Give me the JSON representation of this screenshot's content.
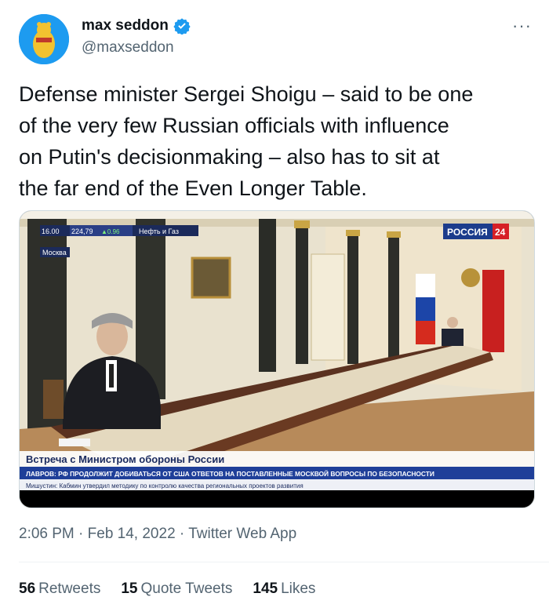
{
  "author": {
    "name": "max seddon",
    "handle": "@maxseddon",
    "verified": true,
    "avatar_icon": "bear-avatar-icon"
  },
  "more_icon": "more-options-icon",
  "tweet_text": "Defense minister Sergei Shoigu – said to be one\nof the very few Russian officials with influence\non Putin's decisionmaking – also has to sit at\nthe far end of the Even Longer Table.",
  "media": {
    "ticker_time": "16.00",
    "ticker_value": "224,79",
    "ticker_change": "▲0.96",
    "ticker_sector": "Нефть и Газ",
    "location": "Москва",
    "channel_logo": "РОССИЯ",
    "channel_number": "24",
    "headline": "Встреча с Министром обороны России",
    "crawl_1": "ЛАВРОВ: РФ ПРОДОЛЖИТ ДОБИВАТЬСЯ ОТ США ОТВЕТОВ НА ПОСТАВЛЕННЫЕ МОСКВОЙ ВОПРОСЫ ПО БЕЗОПАСНОСТИ",
    "crawl_2": "Мишустин: Кабмин утвердил методику по контролю качества региональных проектов развития"
  },
  "meta": {
    "time": "2:06 PM",
    "date": "Feb 14, 2022",
    "source": "Twitter Web App",
    "separator": " · "
  },
  "stats": [
    {
      "count": "56",
      "label": "Retweets"
    },
    {
      "count": "15",
      "label": "Quote Tweets"
    },
    {
      "count": "145",
      "label": "Likes"
    }
  ],
  "colors": {
    "text": "#0f1419",
    "secondary": "#536471",
    "verified": "#1d9bf0",
    "news_blue": "#1f3f99"
  }
}
